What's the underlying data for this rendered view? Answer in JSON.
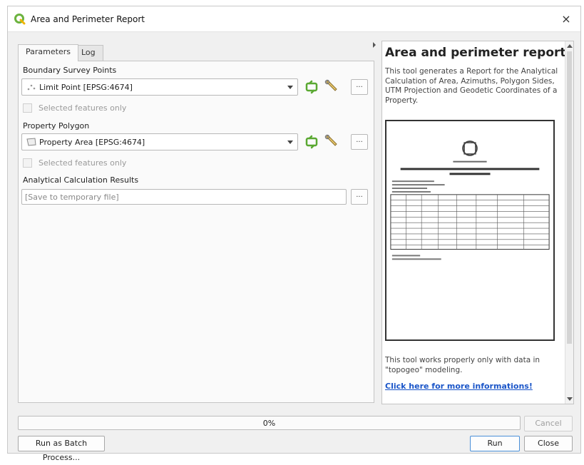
{
  "window": {
    "title": "Area and Perimeter Report",
    "close_glyph": "×"
  },
  "tabs": [
    {
      "label": "Parameters"
    },
    {
      "label": "Log"
    }
  ],
  "params": {
    "boundary_label": "Boundary Survey Points",
    "boundary_value": "Limit Point [EPSG:4674]",
    "boundary_selected_only": "Selected features only",
    "polygon_label": "Property Polygon",
    "polygon_value": "Property Area [EPSG:4674]",
    "polygon_selected_only": "Selected features only",
    "results_label": "Analytical Calculation Results",
    "results_placeholder": "[Save to temporary file]",
    "more_button": "..."
  },
  "help": {
    "title": "Area and perimeter report",
    "description": "This tool generates a Report for the Analytical Calculation of Area, Azimuths, Polygon Sides, UTM Projection and Geodetic Coordinates of a Property.",
    "note": "This tool works properly only with data in \"topogeo\" modeling.",
    "link": "Click here for more informations!"
  },
  "progress": {
    "value": 0,
    "label": "0%"
  },
  "buttons": {
    "cancel": "Cancel",
    "batch": "Run as Batch Process...",
    "run": "Run",
    "close": "Close"
  },
  "colors": {
    "link": "#1a55c8",
    "qgis_green": "#6cb33f",
    "accent": "#4a8fd8"
  }
}
